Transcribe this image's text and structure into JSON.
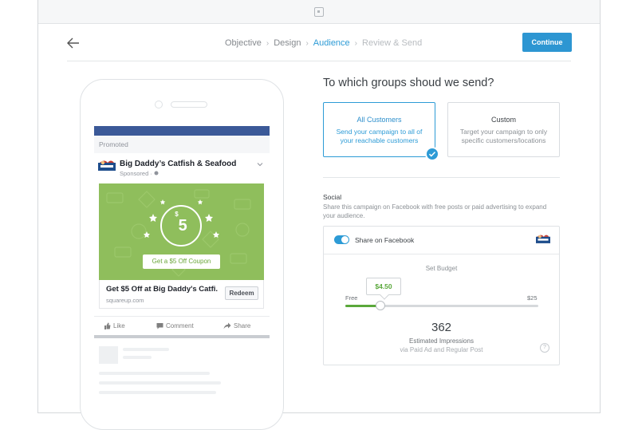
{
  "nav": {
    "steps": [
      {
        "label": "Objective",
        "state": "done"
      },
      {
        "label": "Design",
        "state": "done"
      },
      {
        "label": "Audience",
        "state": "active"
      },
      {
        "label": "Review & Send",
        "state": "future"
      }
    ],
    "separator": "›",
    "continue_label": "Continue"
  },
  "preview": {
    "promoted": "Promoted",
    "business_name": "Big Daddy’s Catfish & Seafood",
    "sponsored": "Sponsored · ",
    "coupon_amount": "5",
    "coupon_symbol": "$",
    "coupon_cta": "Get a $5 Off Coupon",
    "ad_title": "Get $5 Off at Big Daddy's Catfi...",
    "ad_url": "squareup.com",
    "redeem_label": "Redeem",
    "actions": {
      "like": "Like",
      "comment": "Comment",
      "share": "Share"
    }
  },
  "audience": {
    "question": "To which groups shoud we send?",
    "options": [
      {
        "title": "All Customers",
        "description": "Send your campaign to all of your reachable customers",
        "selected": true
      },
      {
        "title": "Custom",
        "description": "Target your campaign to only specific customers/locations",
        "selected": false
      }
    ]
  },
  "social": {
    "heading": "Social",
    "description": "Share this campaign on Facebook with free posts or paid advertising to expand your audience.",
    "share_label": "Share on Facebook",
    "share_enabled": true,
    "budget_heading": "Set Budget",
    "budget_value": "$4.50",
    "budget_fraction": 0.18,
    "min_label": "Free",
    "max_label": "$25",
    "impressions": "362",
    "impressions_label": "Estimated Impressions",
    "impressions_sub": "via Paid Ad and Regular Post",
    "help_glyph": "?"
  },
  "colors": {
    "accent": "#2d9bd6",
    "facebook": "#3b5998",
    "green": "#5aa83b",
    "ad_bg": "#8fbe5c"
  }
}
